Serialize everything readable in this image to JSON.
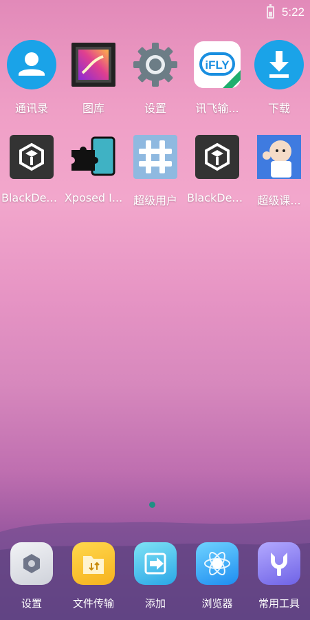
{
  "status_bar": {
    "time": "5:22",
    "battery_icon": "battery-icon"
  },
  "apps": [
    {
      "label": "通讯录",
      "icon": "contacts-icon",
      "color": "#1aa3e8"
    },
    {
      "label": "图库",
      "icon": "gallery-icon",
      "color": "#d44ab7"
    },
    {
      "label": "设置",
      "icon": "settings-gear-icon",
      "color": "#6c7d86"
    },
    {
      "label": "讯飞输...",
      "icon": "ifly-icon",
      "color": "#1a8fe0"
    },
    {
      "label": "下载",
      "icon": "download-icon",
      "color": "#1aa3e8"
    },
    {
      "label": "BlackDex...",
      "icon": "blackdex-icon",
      "color": "#333333"
    },
    {
      "label": "Xposed I...",
      "icon": "xposed-icon",
      "color": "#3fb2c4"
    },
    {
      "label": "超级用户",
      "icon": "superuser-icon",
      "color": "#8fb9e0"
    },
    {
      "label": "BlackDex...",
      "icon": "blackdex-icon",
      "color": "#333333"
    },
    {
      "label": "超级课...",
      "icon": "super-course-icon",
      "color": "#3f7be0"
    }
  ],
  "dock": [
    {
      "label": "设置",
      "icon": "settings-icon"
    },
    {
      "label": "文件传输",
      "icon": "file-transfer-icon"
    },
    {
      "label": "添加",
      "icon": "add-icon"
    },
    {
      "label": "浏览器",
      "icon": "browser-icon"
    },
    {
      "label": "常用工具",
      "icon": "tools-icon"
    }
  ],
  "page_indicator": {
    "current": 1,
    "total": 1
  }
}
